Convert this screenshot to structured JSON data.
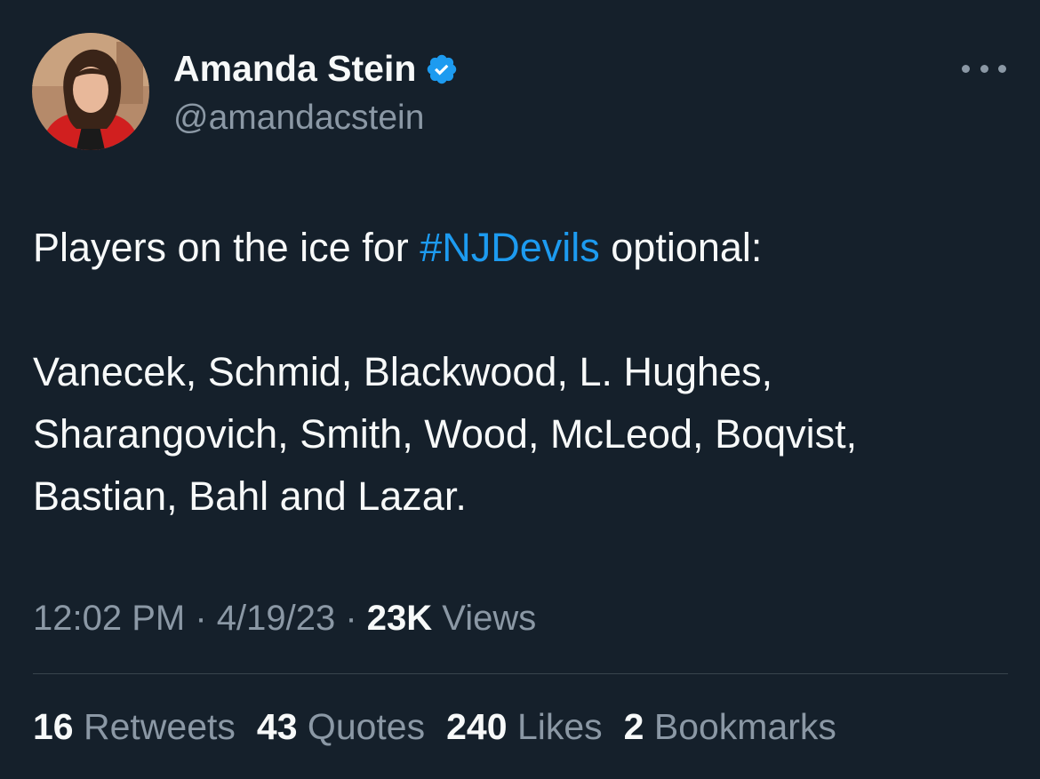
{
  "author": {
    "display_name": "Amanda Stein",
    "handle": "@amandacstein",
    "verified": true,
    "avatar_icon": "profile-photo"
  },
  "tweet": {
    "line1_pre": "Players on the ice for ",
    "hashtag": "#NJDevils",
    "line1_post": " optional:",
    "line2": "Vanecek, Schmid, Blackwood, L. Hughes,",
    "line3": "Sharangovich, Smith, Wood, McLeod, Boqvist,",
    "line4": "Bastian, Bahl and Lazar."
  },
  "meta": {
    "time": "12:02 PM",
    "sep1": " · ",
    "date": "4/19/23",
    "sep2": " · ",
    "views_count": "23K",
    "views_label": " Views"
  },
  "stats": [
    {
      "count": "16",
      "label": " Retweets"
    },
    {
      "count": "43",
      "label": " Quotes"
    },
    {
      "count": "240",
      "label": " Likes"
    },
    {
      "count": "2",
      "label": " Bookmarks"
    }
  ],
  "colors": {
    "background": "#15202b",
    "accent": "#1d9bf0",
    "secondary_text": "#8b98a5",
    "primary_text": "#f7f9f9"
  }
}
